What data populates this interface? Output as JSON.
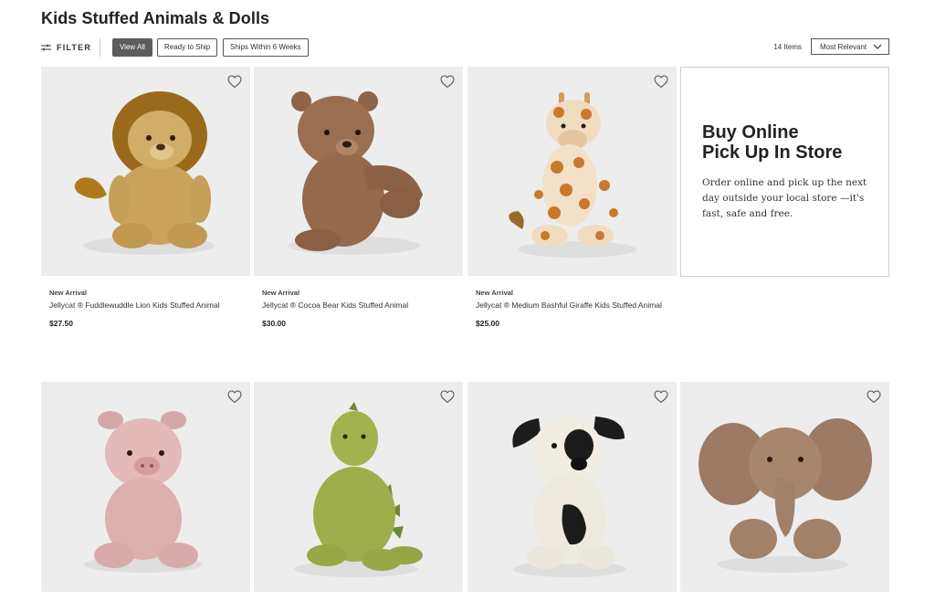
{
  "page": {
    "title": "Kids Stuffed Animals & Dolls"
  },
  "toolbar": {
    "filter_label": "FILTER",
    "chips": [
      "View All",
      "Ready to Ship",
      "Ships Within 6 Weeks"
    ],
    "active_chip": "View All",
    "item_count": "14 Items",
    "sort_value": "Most Relevant"
  },
  "products": [
    {
      "badge": "New Arrival",
      "name": "Jellycat ® Fuddlewuddle Lion Kids Stuffed Animal",
      "price": "$27.50",
      "image": "lion"
    },
    {
      "badge": "New Arrival",
      "name": "Jellycat ® Cocoa Bear Kids Stuffed Animal",
      "price": "$30.00",
      "image": "bear"
    },
    {
      "badge": "New Arrival",
      "name": "Jellycat ® Medium Bashful Giraffe Kids Stuffed Animal",
      "price": "$25.00",
      "image": "giraffe"
    },
    {
      "image": "pig"
    },
    {
      "image": "dinosaur"
    },
    {
      "image": "puppy"
    },
    {
      "image": "elephant"
    }
  ],
  "promo": {
    "title_line1": "Buy Online",
    "title_line2": "Pick Up In Store",
    "text": "Order online and pick up the next day outside your local store —it's fast, safe and free."
  },
  "icons": {
    "filter": "sliders-icon",
    "sort": "chevron-down-icon",
    "wishlist": "heart-outline-icon"
  },
  "colors": {
    "active_chip": "#5c5c5c",
    "tile_bg": "#ededed",
    "promo_border": "#cfcfcf"
  }
}
